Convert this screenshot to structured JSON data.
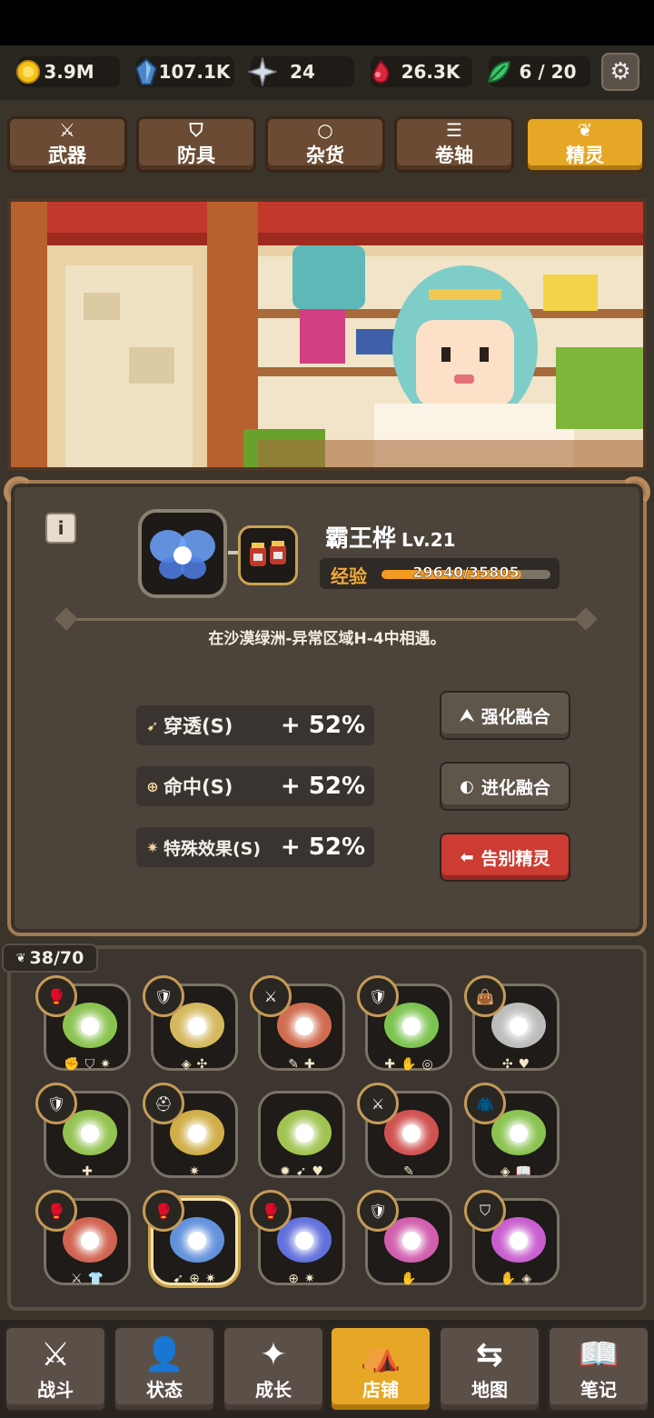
{
  "resources": [
    {
      "icon": "gold-coin-icon",
      "value": "3.9M"
    },
    {
      "icon": "blue-crystal-icon",
      "value": "107.1K"
    },
    {
      "icon": "sparkle-star-icon",
      "value": "24"
    },
    {
      "icon": "red-gem-icon",
      "value": "26.3K"
    },
    {
      "icon": "green-leaf-icon",
      "value": "6 / 20"
    }
  ],
  "tabs": [
    {
      "label": "武器",
      "icon": "sword-icon"
    },
    {
      "label": "防具",
      "icon": "shield-icon"
    },
    {
      "label": "杂货",
      "icon": "ring-icon"
    },
    {
      "label": "卷轴",
      "icon": "scroll-icon"
    },
    {
      "label": "精灵",
      "icon": "fairy-icon",
      "active": true
    }
  ],
  "spirit": {
    "name": "霸王桦",
    "level": "Lv.21",
    "exp_label": "经验",
    "exp_text": "29640/35805",
    "exp_fraction": 0.828,
    "location": "在沙漠绿洲-异常区域H-4中相遇。"
  },
  "stats": [
    {
      "icon": "penetration-icon",
      "name": "穿透(S)",
      "value": "+ 52%"
    },
    {
      "icon": "crosshair-icon",
      "name": "命中(S)",
      "value": "+ 52%"
    },
    {
      "icon": "burst-icon",
      "name": "特殊效果(S)",
      "value": "+ 52%"
    }
  ],
  "actions": [
    {
      "label": "强化融合",
      "icon": "up-arrow-icon"
    },
    {
      "label": "进化融合",
      "icon": "moon-icon"
    },
    {
      "label": "告别精灵",
      "icon": "left-arrow-icon"
    }
  ],
  "collection": {
    "count": "38/70"
  },
  "nav": [
    {
      "label": "战斗",
      "icon": "crossed-swords-icon"
    },
    {
      "label": "状态",
      "icon": "person-icon"
    },
    {
      "label": "成长",
      "icon": "star-icon"
    },
    {
      "label": "店铺",
      "icon": "tent-icon",
      "active": true
    },
    {
      "label": "地图",
      "icon": "signpost-icon"
    },
    {
      "label": "笔记",
      "icon": "book-icon"
    }
  ],
  "colors": {
    "accent": "#e6a727",
    "danger": "#cc3c33",
    "panel": "#4c443b",
    "exp": "#f39a22"
  }
}
